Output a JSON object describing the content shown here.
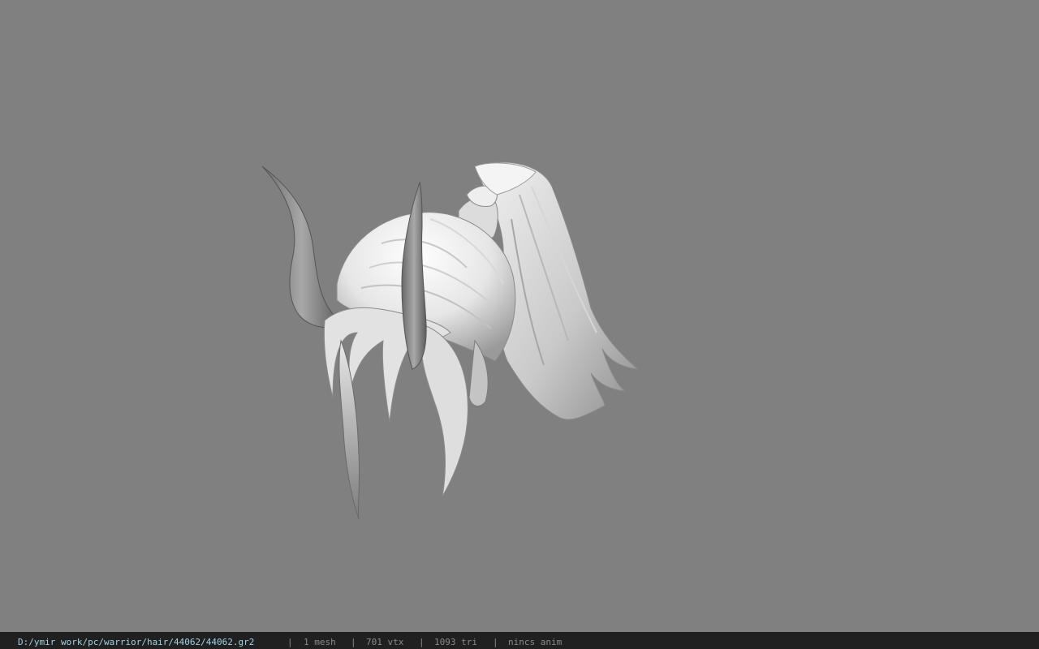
{
  "viewer": {
    "background_color": "#808080",
    "model_label": "hair-model"
  },
  "status_bar": {
    "file_path": "D:/ymir work/pc/warrior/hair/44062/44062.gr2",
    "separator": "|",
    "mesh_count": "1 mesh",
    "vertex_count": "701 vtx",
    "triangle_count": "1093 tri",
    "animation": "nincs anim"
  }
}
